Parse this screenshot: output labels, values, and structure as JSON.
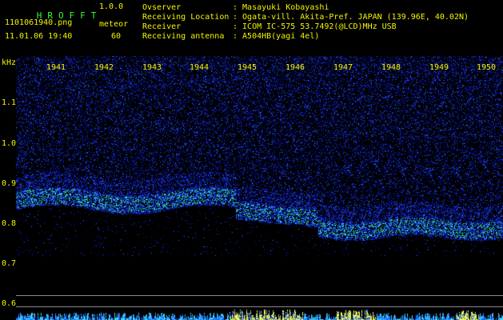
{
  "app": {
    "title_letters": [
      "H",
      "R",
      "O",
      "F",
      "F",
      "T"
    ],
    "version": "1.0.0",
    "filename": "1101061940.png",
    "datetime": "11.01.06 19:40",
    "meteor_label": "meteor",
    "meteor_count": "60"
  },
  "info": {
    "rows": [
      {
        "label": "Ovserver",
        "value": ": Masayuki Kobayashi"
      },
      {
        "label": "Receiving Location",
        "value": ": Ogata-vill. Akita-Pref. JAPAN (139.96E, 40.02N)"
      },
      {
        "label": "Receiver",
        "value": ": ICOM IC-575 53.7492(@LCD)MHz USB"
      },
      {
        "label": "Receiving antenna",
        "value": ": A504HB(yagi 4el)"
      }
    ]
  },
  "axis": {
    "unit": "kHz",
    "y_labels": [
      "1.1",
      "1.0",
      "0.9",
      "0.8",
      "0.7",
      "0.6"
    ],
    "minute_labels": [
      "1941",
      "1942",
      "1943",
      "1944",
      "1945",
      "1946",
      "1947",
      "1948",
      "1949",
      "1950"
    ]
  },
  "colors": {
    "text_green": "#32ff32",
    "text_yellow": "#f4f400",
    "noise_blue": "#1a2cff",
    "echo_green": "#40ff90",
    "bar_yellow": "#ffff40",
    "bar_cyan": "#40e0ff"
  }
}
